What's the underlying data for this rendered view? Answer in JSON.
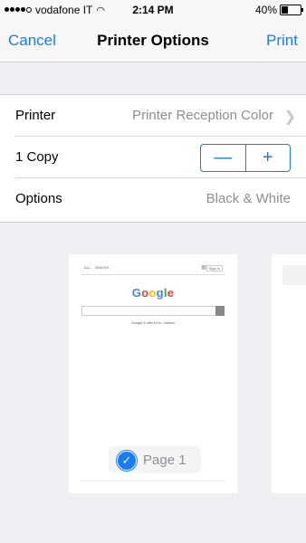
{
  "status_bar": {
    "carrier": "vodafone IT",
    "time": "2:14 PM",
    "battery": "40%",
    "battery_level": 0.4
  },
  "nav": {
    "cancel": "Cancel",
    "title": "Printer Options",
    "print": "Print"
  },
  "settings": {
    "printer": {
      "label": "Printer",
      "value": "Printer Reception Color"
    },
    "copies": {
      "label": "1 Copy",
      "minus": "—",
      "plus": "+"
    },
    "options": {
      "label": "Options",
      "value": "Black & White"
    }
  },
  "preview": {
    "page_label": "Page 1",
    "selected": true,
    "doc": {
      "top_left_a": "ALL",
      "top_left_b": "IMAGES",
      "signin": "Sign in",
      "logo": [
        "G",
        "o",
        "o",
        "g",
        "l",
        "e"
      ],
      "offer": "Google.it offered in: Italiano"
    }
  },
  "colors": {
    "accent": "#1b7cf2",
    "background": "#efeff4",
    "secondary_text": "#8e8e93"
  }
}
